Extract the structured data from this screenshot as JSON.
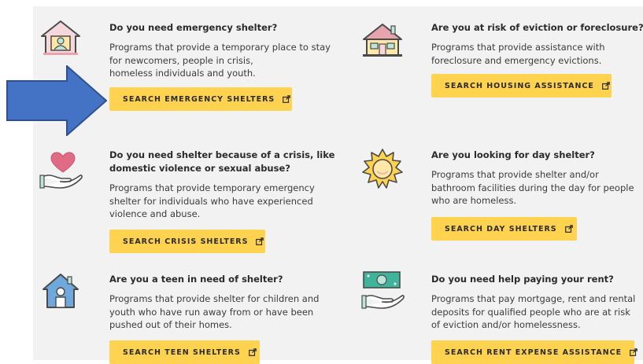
{
  "cards": [
    {
      "id": "emergency",
      "title": "Do you need emergency shelter?",
      "desc": "Programs that provide a temporary place to stay for newcomers, people in crisis,\nhomeless individuals and youth.",
      "button": "SEARCH EMERGENCY SHELTERS",
      "icon": "house-person-icon"
    },
    {
      "id": "eviction",
      "title": "Are you at risk of eviction or foreclosure?",
      "desc": "Programs that provide assistance with foreclosure and emergency evictions.",
      "button": "SEARCH HOUSING ASSISTANCE",
      "icon": "house-icon"
    },
    {
      "id": "crisis",
      "title": "Do you need shelter because of a crisis, like domestic violence or sexual abuse?",
      "desc": "Programs that provide temporary emergency shelter for individuals who have experienced violence and abuse.",
      "button": "SEARCH CRISIS SHELTERS",
      "icon": "heart-hand-icon"
    },
    {
      "id": "day",
      "title": "Are you looking for day shelter?",
      "desc": "Programs that provide shelter and/or bathroom facilities during the day for people who are homeless.",
      "button": "SEARCH DAY SHELTERS",
      "icon": "sun-icon"
    },
    {
      "id": "teen",
      "title": "Are you a teen in need of shelter?",
      "desc": "Programs that provide shelter for children and youth who have run away from or have been pushed out of their homes.",
      "button": "SEARCH TEEN SHELTERS",
      "icon": "teen-house-icon"
    },
    {
      "id": "rent",
      "title": "Do you need help paying your rent?",
      "desc": "Programs that pay mortgage, rent and rental deposits for qualified people who are at risk of eviction and/or homelessness.",
      "button": "SEARCH RENT EXPENSE ASSISTANCE",
      "icon": "money-hand-icon"
    }
  ],
  "colors": {
    "button": "#ffd34f",
    "arrow": "#4472c4",
    "panel": "#f2f2f2"
  }
}
